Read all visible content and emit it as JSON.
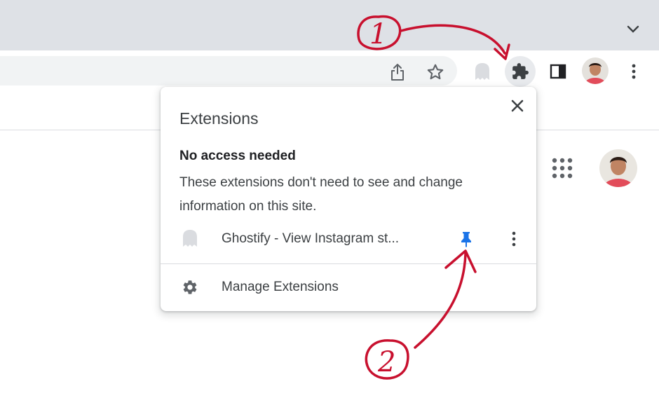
{
  "popup": {
    "title": "Extensions",
    "section_heading": "No access needed",
    "section_description": "These extensions don't need to see and change information on this site.",
    "extension_name": "Ghostify - View Instagram st...",
    "manage_label": "Manage Extensions"
  },
  "annotations": {
    "step1": "1",
    "step2": "2"
  },
  "colors": {
    "pin": "#1a73e8",
    "annotation": "#c8102e",
    "tabstrip": "#dee1e6",
    "omnibox": "#f1f3f4"
  },
  "icons": [
    "chevron-down-icon",
    "share-icon",
    "star-icon",
    "ghostify-icon",
    "puzzle-icon",
    "side-panel-icon",
    "avatar",
    "kebab-menu-icon",
    "apps-grid-icon",
    "close-icon",
    "pin-icon",
    "gear-icon"
  ]
}
